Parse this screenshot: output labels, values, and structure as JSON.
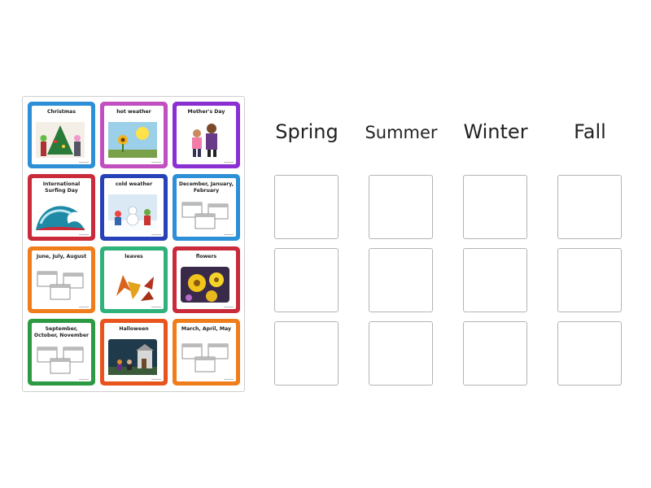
{
  "tray": {
    "cards": [
      {
        "label": "Christmas",
        "color": "#2d8fd6",
        "art": "christmas-tree-icon"
      },
      {
        "label": "hot weather",
        "color": "#c24fc0",
        "art": "sun-icon"
      },
      {
        "label": "Mother's Day",
        "color": "#8a2fd1",
        "art": "family-icon"
      },
      {
        "label": "International Surfing Day",
        "color": "#c92b3a",
        "art": "wave-icon"
      },
      {
        "label": "cold weather",
        "color": "#2742b8",
        "art": "snowman-icon"
      },
      {
        "label": "December, January, February",
        "color": "#2d8fd6",
        "art": "calendar-icon"
      },
      {
        "label": "June, July, August",
        "color": "#f07d1c",
        "art": "calendar-icon"
      },
      {
        "label": "leaves",
        "color": "#2fb27a",
        "art": "leaf-icon"
      },
      {
        "label": "flowers",
        "color": "#c92b3a",
        "art": "flower-icon"
      },
      {
        "label": "September, October, November",
        "color": "#2b9a42",
        "art": "calendar-icon"
      },
      {
        "label": "Halloween",
        "color": "#e8541c",
        "art": "haunted-house-icon"
      },
      {
        "label": "March, April, May",
        "color": "#f07d1c",
        "art": "calendar-icon"
      }
    ]
  },
  "columns": [
    {
      "label": "Spring"
    },
    {
      "label": "Summer"
    },
    {
      "label": "Winter"
    },
    {
      "label": "Fall"
    }
  ]
}
